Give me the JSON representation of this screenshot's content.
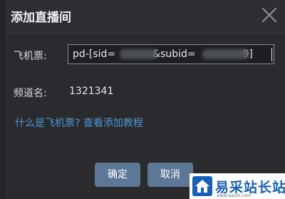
{
  "dialog": {
    "title": "添加直播间",
    "close_icon": "close-icon"
  },
  "form": {
    "ticket_label": "飞机票:",
    "ticket_value": "pd-[sid=",
    "ticket_value_mid": "&subid=",
    "ticket_value_end": "9]",
    "channel_label": "频道名:",
    "channel_value": "1321341",
    "help_link": "什么是飞机票? 查看添加教程"
  },
  "buttons": {
    "ok": "确定",
    "cancel": "取消"
  },
  "watermark": {
    "text": "易采站长站",
    "subtext": "www.easck.com"
  },
  "colors": {
    "background": "#2b2b2d",
    "link": "#4b97d6",
    "button": "#5d7796"
  }
}
